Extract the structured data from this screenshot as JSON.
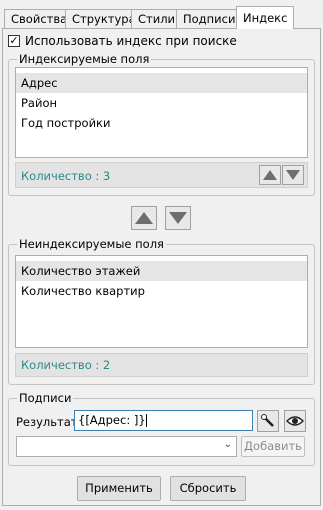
{
  "tabs": [
    {
      "label": "Свойства",
      "active": false
    },
    {
      "label": "Структура",
      "active": false
    },
    {
      "label": "Стили",
      "active": false
    },
    {
      "label": "Подписи",
      "active": false
    },
    {
      "label": "Индекс",
      "active": true
    }
  ],
  "use_index": {
    "label": "Использовать индекс при поиске",
    "checked": true
  },
  "indexed": {
    "title": "Индексируемые поля",
    "items": [
      "Адрес",
      "Район",
      "Год постройки"
    ],
    "count_text": "Количество :  3"
  },
  "non_indexed": {
    "title": "Неиндексируемые поля",
    "items": [
      "Количество этажей",
      "Количество квартир"
    ],
    "count_text": "Количество :  2"
  },
  "captions": {
    "title": "Подписи",
    "result_label": "Результат",
    "result_value": "{[Адрес: ]}",
    "combo_value": "",
    "add_label": "Добавить"
  },
  "buttons": {
    "apply": "Применить",
    "reset": "Сбросить"
  },
  "colors": {
    "count_text": "#2b8a8a",
    "arrow_fill": "#6e6e6e"
  }
}
